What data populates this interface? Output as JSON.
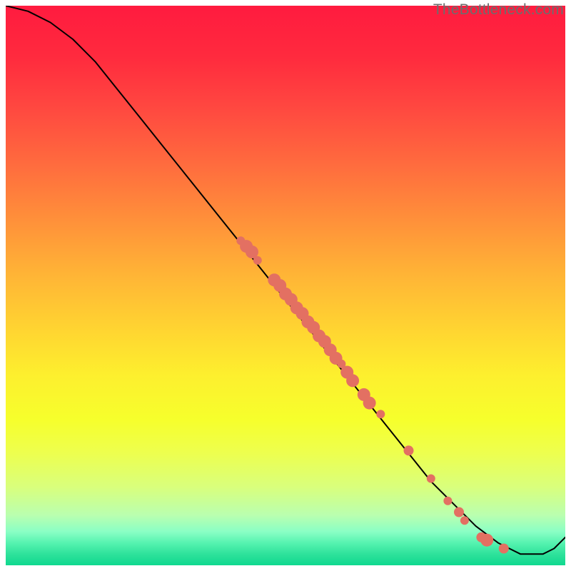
{
  "watermark": "TheBottleneck.com",
  "colors": {
    "curve": "#000000",
    "points": "#e37062"
  },
  "chart_data": {
    "type": "line",
    "title": "",
    "xlabel": "",
    "ylabel": "",
    "xlim": [
      0,
      100
    ],
    "ylim": [
      0,
      100
    ],
    "grid": false,
    "legend": false,
    "series": [
      {
        "name": "curve",
        "x": [
          0,
          4,
          8,
          12,
          16,
          20,
          24,
          28,
          32,
          36,
          40,
          44,
          48,
          52,
          56,
          60,
          64,
          68,
          72,
          76,
          80,
          84,
          88,
          90,
          92,
          94,
          96,
          98,
          100
        ],
        "y": [
          100,
          99,
          97,
          94,
          90,
          85,
          80,
          75,
          70,
          65,
          60,
          55,
          50,
          45,
          40,
          35,
          30,
          25,
          20,
          15,
          11,
          7,
          4,
          3,
          2,
          2,
          2,
          3,
          5
        ]
      }
    ],
    "points": [
      {
        "x": 42,
        "y": 58
      },
      {
        "x": 43,
        "y": 57
      },
      {
        "x": 44,
        "y": 56
      },
      {
        "x": 45,
        "y": 54.5
      },
      {
        "x": 48,
        "y": 51
      },
      {
        "x": 49,
        "y": 50
      },
      {
        "x": 50,
        "y": 48.5
      },
      {
        "x": 51,
        "y": 47.5
      },
      {
        "x": 52,
        "y": 46
      },
      {
        "x": 53,
        "y": 45
      },
      {
        "x": 54,
        "y": 43.5
      },
      {
        "x": 55,
        "y": 42.5
      },
      {
        "x": 56,
        "y": 41
      },
      {
        "x": 57,
        "y": 40
      },
      {
        "x": 58,
        "y": 38.5
      },
      {
        "x": 59,
        "y": 37
      },
      {
        "x": 60,
        "y": 36
      },
      {
        "x": 61,
        "y": 34.5
      },
      {
        "x": 62,
        "y": 33
      },
      {
        "x": 64,
        "y": 30.5
      },
      {
        "x": 65,
        "y": 29
      },
      {
        "x": 67,
        "y": 27
      },
      {
        "x": 72,
        "y": 20.5
      },
      {
        "x": 76,
        "y": 15.5
      },
      {
        "x": 79,
        "y": 11.5
      },
      {
        "x": 81,
        "y": 9.5
      },
      {
        "x": 82,
        "y": 8
      },
      {
        "x": 85,
        "y": 5
      },
      {
        "x": 86,
        "y": 4.5
      },
      {
        "x": 89,
        "y": 3
      }
    ],
    "point_sizes": [
      6,
      9,
      9,
      6,
      9,
      9,
      9,
      9,
      9,
      9,
      9,
      9,
      9,
      9,
      9,
      9,
      6,
      9,
      9,
      9,
      9,
      6,
      7,
      6,
      6,
      7,
      6,
      7,
      9,
      7
    ]
  }
}
